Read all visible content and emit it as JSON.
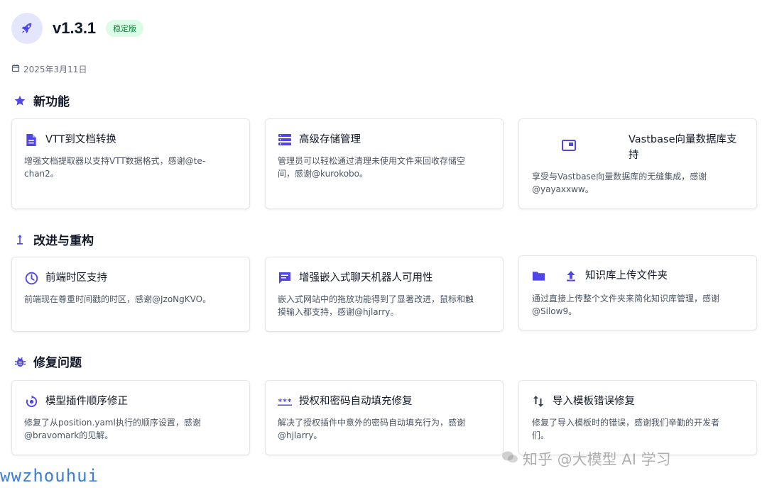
{
  "header": {
    "version": "v1.3.1",
    "badge": "稳定版",
    "date": "2025年3月11日"
  },
  "sections": {
    "new_features": {
      "title": "新功能",
      "cards": [
        {
          "icon": "document-icon",
          "title": "VTT到文档转换",
          "desc": "增强文档提取器以支持VTT数据格式，感谢@te-chan2。"
        },
        {
          "icon": "storage-icon",
          "title": "高级存储管理",
          "desc": "管理员可以轻松通过清理未使用文件来回收存储空间，感谢@kurokobo。"
        },
        {
          "icon": "window-icon",
          "title": "Vastbase向量数据库支持",
          "desc": "享受与Vastbase向量数据库的无缝集成，感谢@yayaxxww。"
        }
      ]
    },
    "improvements": {
      "title": "改进与重构",
      "cards": [
        {
          "icon": "clock-icon",
          "title": "前端时区支持",
          "desc": "前端现在尊重时间戳的时区，感谢@JzoNgKVO。"
        },
        {
          "icon": "chat-icon",
          "title": "增强嵌入式聊天机器人可用性",
          "desc": "嵌入式网站中的拖放功能得到了显著改进，鼠标和触摸输入都支持，感谢@hjlarry。"
        },
        {
          "icon": "folder-upload-icon",
          "title": "知识库上传文件夹",
          "desc": "通过直接上传整个文件夹来简化知识库管理，感谢@Silow9。"
        }
      ]
    },
    "fixes": {
      "title": "修复问题",
      "cards": [
        {
          "icon": "plugin-order-icon",
          "title": "模型插件顺序修正",
          "desc": "修复了从position.yaml执行的顺序设置，感谢@bravomark的见解。"
        },
        {
          "icon": "password-icon",
          "title": "授权和密码自动填充修复",
          "desc": "解决了授权插件中意外的密码自动填充行为，感谢@hjlarry。"
        },
        {
          "icon": "swap-icon",
          "title": "导入模板错误修复",
          "desc": "修复了导入模板时的错误，感谢我们辛勤的开发者们。"
        }
      ]
    }
  },
  "watermark": {
    "left": "wwzhouhui",
    "right": "知乎 @大模型 AI 学习"
  },
  "colors": {
    "accent": "#4f46e5",
    "badge_bg": "#dcfce7",
    "badge_text": "#15803d"
  }
}
